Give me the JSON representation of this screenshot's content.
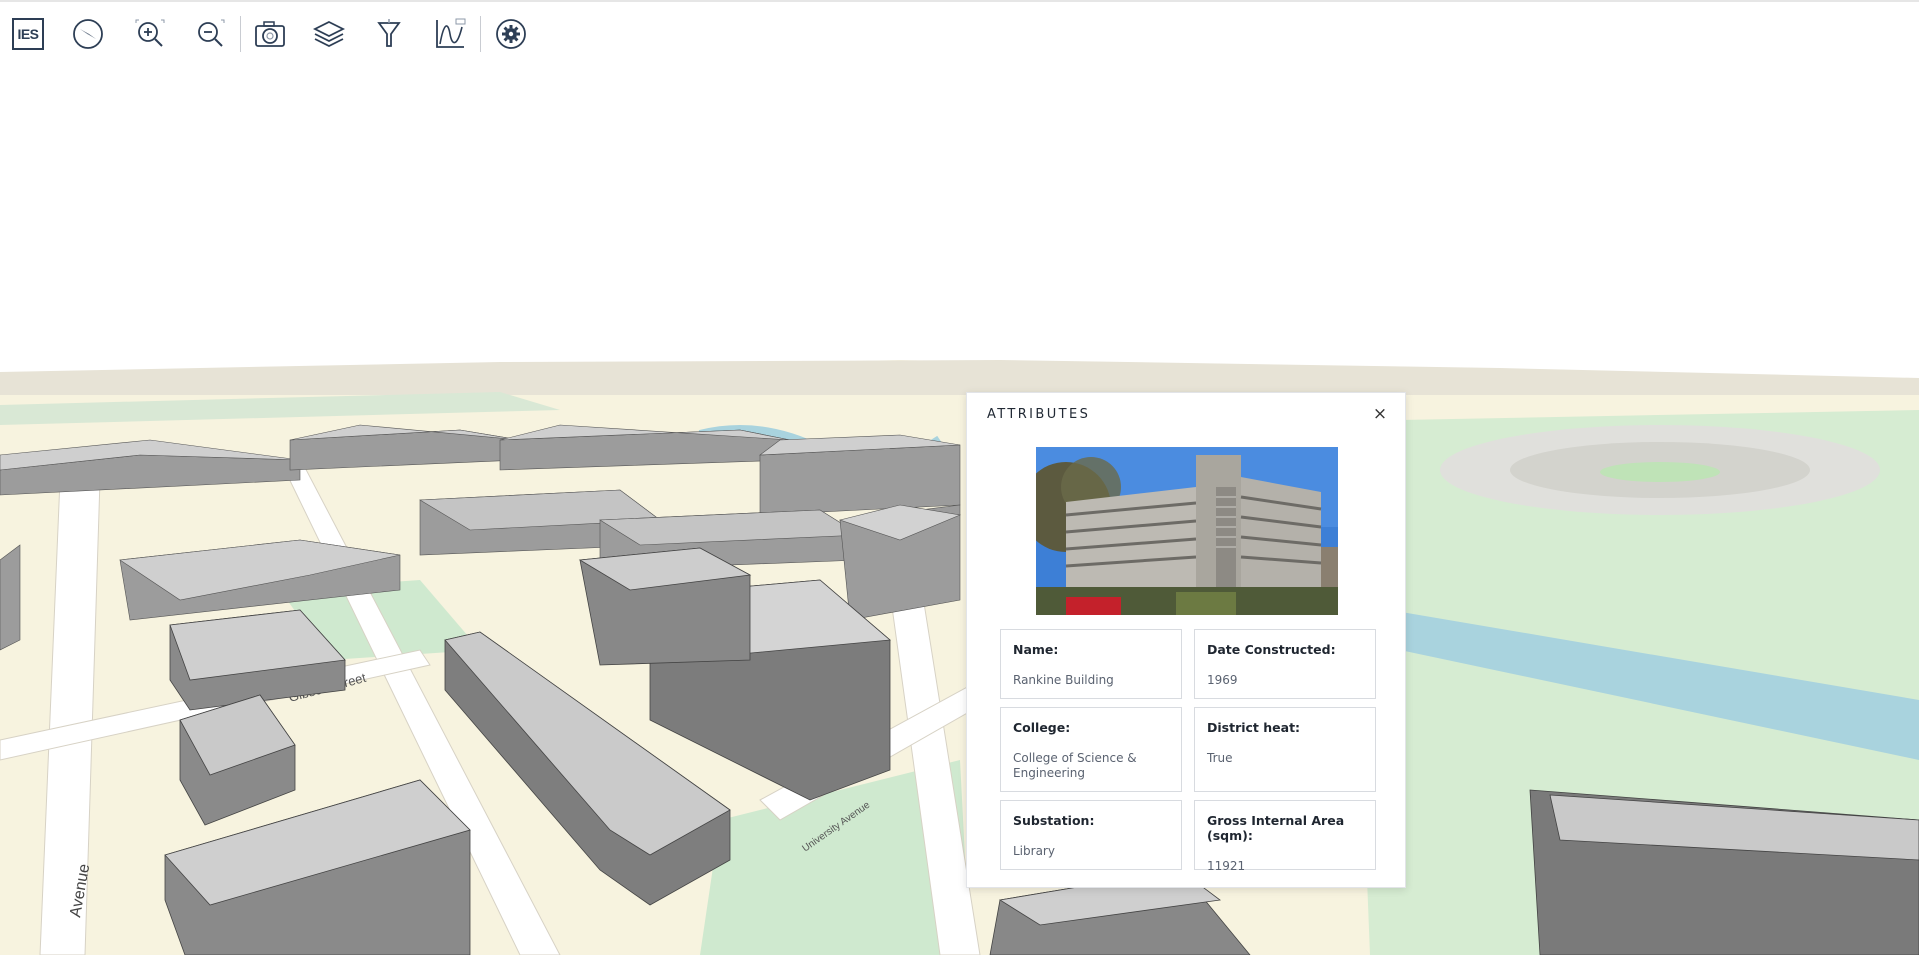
{
  "toolbar": {
    "logo_text": "IES",
    "buttons": [
      {
        "name": "compass-icon"
      },
      {
        "name": "zoom-in-icon"
      },
      {
        "name": "zoom-out-icon"
      },
      {
        "name": "camera-icon"
      },
      {
        "name": "layers-icon"
      },
      {
        "name": "filter-icon"
      },
      {
        "name": "chart-icon"
      },
      {
        "name": "settings-icon"
      }
    ]
  },
  "map": {
    "street_labels": [
      "Gibson Street",
      "University Avenue",
      "Avenue"
    ]
  },
  "attributes_panel": {
    "title": "ATTRIBUTES",
    "close_glyph": "×",
    "fields": {
      "name": {
        "label": "Name:",
        "value": "Rankine Building"
      },
      "date_constructed": {
        "label": "Date Constructed:",
        "value": "1969"
      },
      "college": {
        "label": "College:",
        "value": "College of Science & Engineering"
      },
      "district_heat": {
        "label": "District heat:",
        "value": "True"
      },
      "substation": {
        "label": "Substation:",
        "value": "Library"
      },
      "gross_internal_area": {
        "label": "Gross Internal Area (sqm):",
        "value": "11921"
      }
    }
  },
  "colors": {
    "ground": "#f7f3df",
    "park": "#cfe9cf",
    "building_side": "#8a8a8a",
    "building_top": "#c8c8c8",
    "water": "#a9d3de",
    "toolbar_icon": "#2d3e55"
  }
}
